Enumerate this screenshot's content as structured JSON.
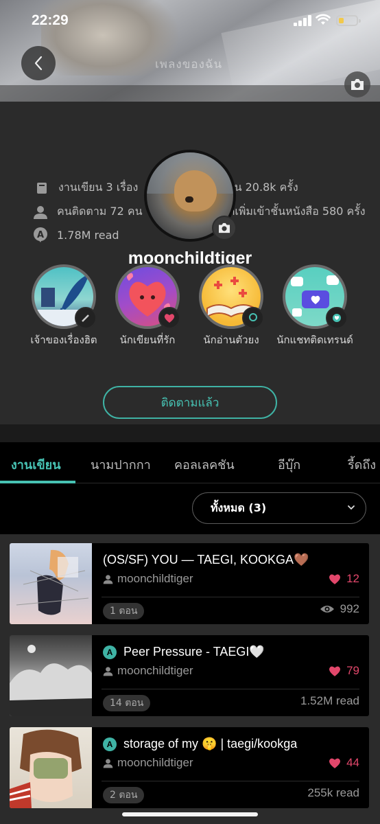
{
  "status_bar": {
    "time": "22:29"
  },
  "cover": {
    "caption": "เพลงของฉัน"
  },
  "profile": {
    "username": "moonchildtiger",
    "stats": {
      "works": "งานเขียน 3 เรื่อง",
      "reads_count": "อ่าน 20.8k ครั้ง",
      "followers": "คนติดตาม 72 คน",
      "library_adds": "ถูกเพิ่มเข้าชั้นหนังสือ 580 ครั้ง",
      "total_read": "1.78M read"
    },
    "badges": [
      {
        "label": "เจ้าของเรื่องฮิต"
      },
      {
        "label": "นักเขียนที่รัก"
      },
      {
        "label": "นักอ่านตัวยง"
      },
      {
        "label": "นักแชทติดเทรนด์"
      }
    ],
    "follow_label": "ติดตามแล้ว"
  },
  "tabs": [
    {
      "label": "งานเขียน",
      "active": true
    },
    {
      "label": "นามปากกา"
    },
    {
      "label": "คอลเลคชัน"
    },
    {
      "label": "อีบุ๊ก"
    },
    {
      "label": "รี้ดถึง"
    }
  ],
  "filter": {
    "selected": "ทั้งหมด (3)"
  },
  "stories": [
    {
      "title": "(OS/SF) YOU — TAEGI, KOOKGA🤎",
      "author": "moonchildtiger",
      "likes": "12",
      "episodes": "1 ตอน",
      "reads": "992",
      "chat_badge": false
    },
    {
      "title": "Peer Pressure - TAEGI🤍",
      "author": "moonchildtiger",
      "likes": "79",
      "episodes": "14 ตอน",
      "reads": "1.52M read",
      "chat_badge": true
    },
    {
      "title": "storage of my 🤫 | taegi/kookga",
      "author": "moonchildtiger",
      "likes": "44",
      "episodes": "2 ตอน",
      "reads": "255k read",
      "chat_badge": true
    }
  ],
  "colors": {
    "accent": "#47c2b3",
    "like": "#e2476b",
    "background": "#2b2b2b"
  }
}
